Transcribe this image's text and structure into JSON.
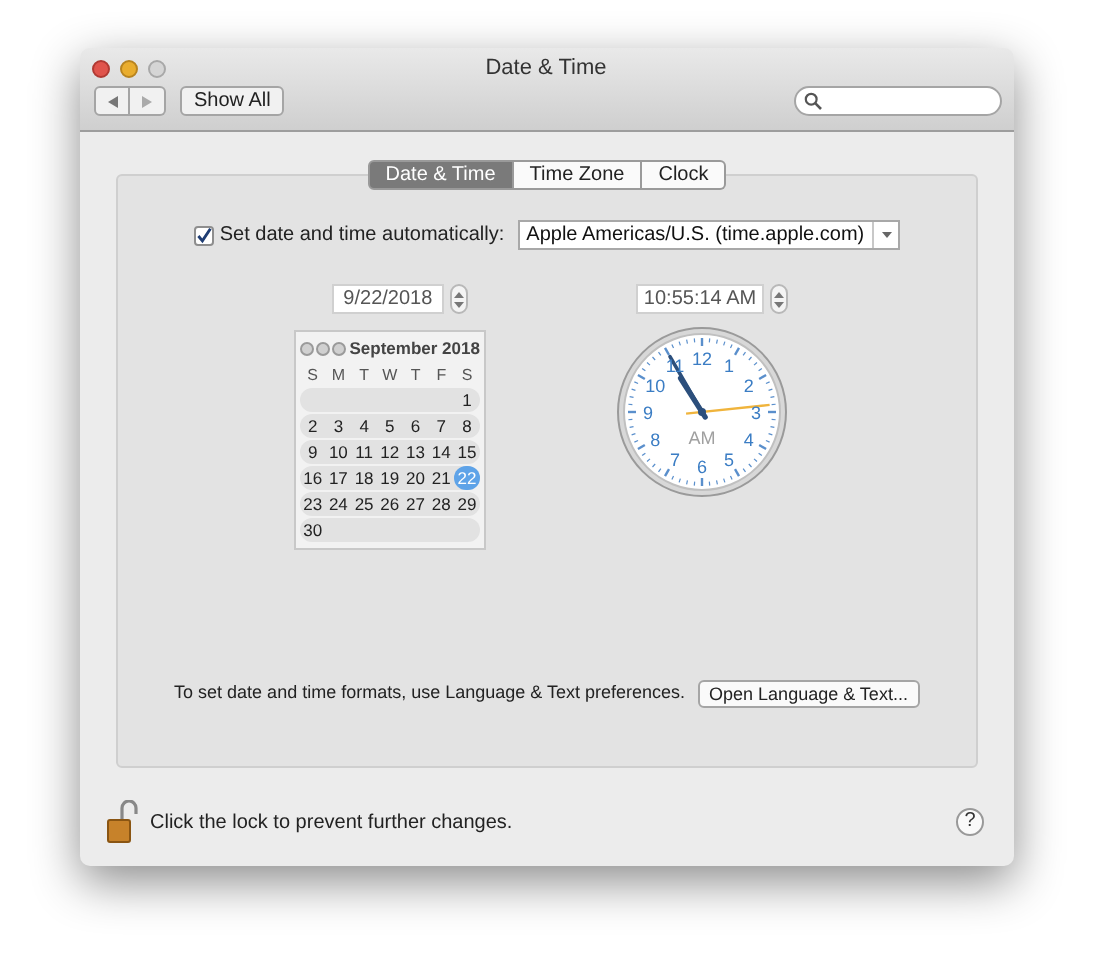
{
  "window": {
    "title": "Date & Time"
  },
  "toolbar": {
    "show_all": "Show All"
  },
  "tabs": [
    {
      "label": "Date & Time",
      "selected": true
    },
    {
      "label": "Time Zone",
      "selected": false
    },
    {
      "label": "Clock",
      "selected": false
    }
  ],
  "auto": {
    "checked": true,
    "label": "Set date and time automatically:",
    "server": "Apple Americas/U.S. (time.apple.com)"
  },
  "date_field": "9/22/2018",
  "time_field": "10:55:14 AM",
  "calendar": {
    "month": "September 2018",
    "weekdays": [
      "S",
      "M",
      "T",
      "W",
      "T",
      "F",
      "S"
    ],
    "weeks": [
      [
        {
          "label": "1",
          "selected": false
        }
      ],
      [
        {
          "label": "2",
          "selected": false
        },
        {
          "label": "3",
          "selected": false
        },
        {
          "label": "4",
          "selected": false
        },
        {
          "label": "5",
          "selected": false
        },
        {
          "label": "6",
          "selected": false
        },
        {
          "label": "7",
          "selected": false
        },
        {
          "label": "8",
          "selected": false
        }
      ],
      [
        {
          "label": "9",
          "selected": false
        },
        {
          "label": "10",
          "selected": false
        },
        {
          "label": "11",
          "selected": false
        },
        {
          "label": "12",
          "selected": false
        },
        {
          "label": "13",
          "selected": false
        },
        {
          "label": "14",
          "selected": false
        },
        {
          "label": "15",
          "selected": false
        }
      ],
      [
        {
          "label": "16",
          "selected": false
        },
        {
          "label": "17",
          "selected": false
        },
        {
          "label": "18",
          "selected": false
        },
        {
          "label": "19",
          "selected": false
        },
        {
          "label": "20",
          "selected": false
        },
        {
          "label": "21",
          "selected": false
        },
        {
          "label": "22",
          "selected": true
        }
      ],
      [
        {
          "label": "23",
          "selected": false
        },
        {
          "label": "24",
          "selected": false
        },
        {
          "label": "25",
          "selected": false
        },
        {
          "label": "26",
          "selected": false
        },
        {
          "label": "27",
          "selected": false
        },
        {
          "label": "28",
          "selected": false
        },
        {
          "label": "29",
          "selected": false
        }
      ],
      [
        {
          "label": "30",
          "selected": false
        }
      ]
    ]
  },
  "clock": {
    "numerals": [
      "12",
      "11",
      "1",
      "10",
      "2",
      "9",
      "3",
      "8",
      "4",
      "7",
      "5",
      "6"
    ],
    "period": "AM"
  },
  "formats": {
    "text": "To set date and time formats, use Language & Text preferences.",
    "button": "Open Language & Text..."
  },
  "lock": {
    "text": "Click the lock to prevent further changes."
  },
  "help": "?"
}
